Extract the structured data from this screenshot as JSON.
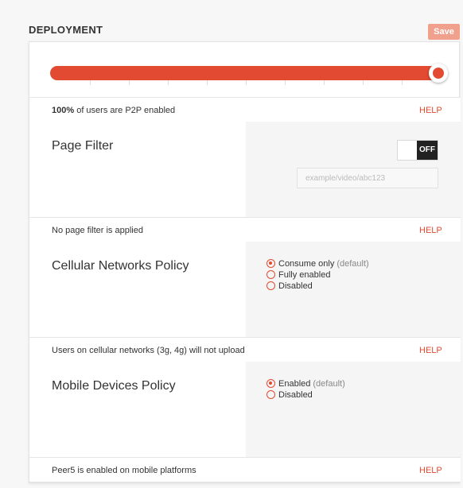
{
  "header": {
    "title": "DEPLOYMENT",
    "save_label": "Save"
  },
  "slider": {
    "value_percent": 100,
    "accent": "#e24a32"
  },
  "sections": {
    "p2p": {
      "percent_text": "100%",
      "summary_text": " of users are P2P enabled",
      "help": "HELP"
    },
    "page_filter": {
      "title": "Page Filter",
      "toggle_label": "OFF",
      "input_placeholder": "example/video/abc123",
      "summary_text": "No page filter is applied",
      "help": "HELP"
    },
    "cellular": {
      "title": "Cellular Networks Policy",
      "options": [
        {
          "label": "Consume only",
          "suffix": "(default)",
          "checked": true
        },
        {
          "label": "Fully enabled",
          "suffix": "",
          "checked": false
        },
        {
          "label": "Disabled",
          "suffix": "",
          "checked": false
        }
      ],
      "summary_text": "Users on cellular networks (3g, 4g) will not upload",
      "help": "HELP"
    },
    "mobile": {
      "title": "Mobile Devices Policy",
      "options": [
        {
          "label": "Enabled",
          "suffix": "(default)",
          "checked": true
        },
        {
          "label": "Disabled",
          "suffix": "",
          "checked": false
        }
      ],
      "summary_text": "Peer5 is enabled on mobile platforms",
      "help": "HELP"
    }
  }
}
